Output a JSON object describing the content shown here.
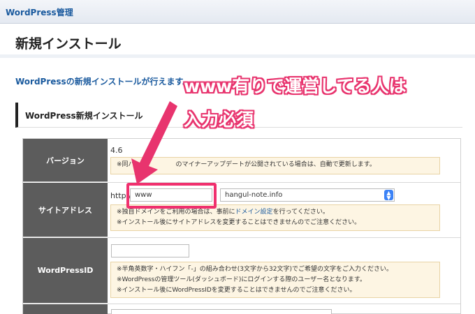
{
  "topbar": {
    "title": "WordPress管理"
  },
  "page": {
    "title": "新規インストール",
    "intro": "WordPressの新規インストールが行えます。"
  },
  "section": {
    "title": "WordPress新規インストール"
  },
  "form": {
    "version": {
      "label": "バージョン",
      "value": "4.6",
      "note_a": "※同バー",
      "note_b": "のマイナーアップデートが公開されている場合は、自動で更新します。"
    },
    "site_address": {
      "label": "サイトアドレス",
      "scheme": "http://",
      "subdomain_value": "www",
      "dot": ".",
      "domain_selected": "hangul-note.info",
      "note_line1_pre": "※独自ドメインをご利用の場合は、事前に",
      "note_line1_link": "ドメイン設定",
      "note_line1_post": "を行ってください。",
      "note_line2": "※インストール後にサイトアドレスを変更することはできませんのでご注意ください。"
    },
    "wordpress_id": {
      "label": "WordPressID",
      "value": "",
      "note_line1": "※半角英数字・ハイフン「-」の組み合わせ(3文字から32文字)でご希望の文字をご入力ください。",
      "note_line2": "※WordPressの管理ツール(ダッシュボード)にログインする際のユーザー名となります。",
      "note_line3": "※インストール後にWordPressIDを変更することはできませんのでご注意ください。"
    }
  },
  "annotation": {
    "line1": "www有りで運営してる人は",
    "line2": "入力必須"
  },
  "colors": {
    "accent": "#e8346e",
    "label_bg": "#5c5c5c",
    "note_bg": "#fdf5e3",
    "link": "#1a5a9e"
  },
  "icons": {
    "select_arrow": "chevron-updown-icon",
    "callout_arrow": "arrow-icon"
  }
}
